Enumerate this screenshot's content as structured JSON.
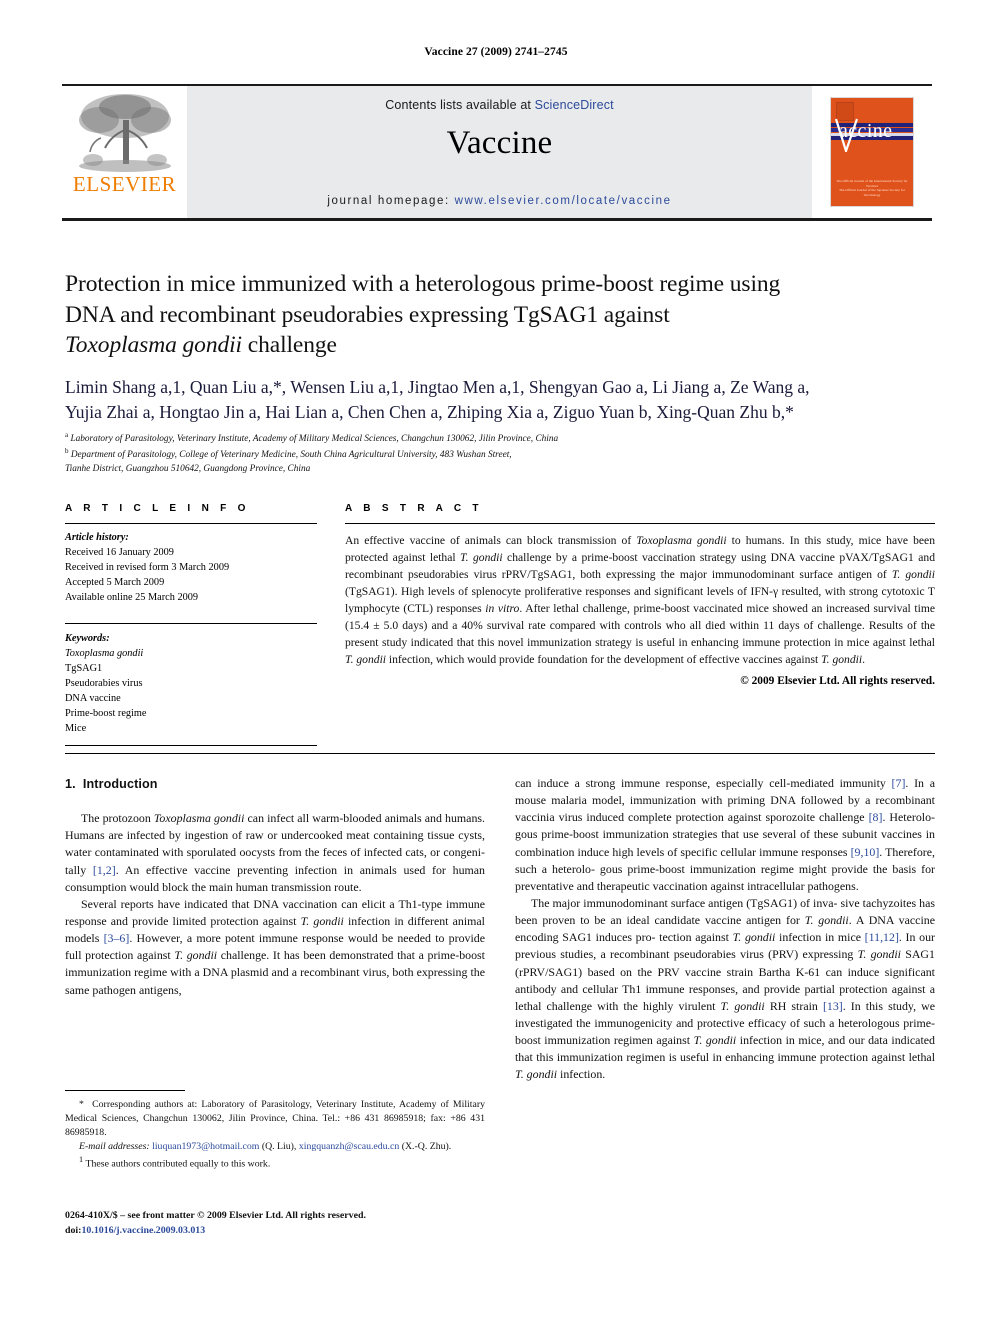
{
  "running_head": "Vaccine 27 (2009) 2741–2745",
  "header": {
    "contents_prefix": "Contents lists available at ",
    "sciencedirect": "ScienceDirect",
    "journal_title": "Vaccine",
    "homepage_prefix": "journal homepage:",
    "homepage_url": "www.elsevier.com/locate/vaccine",
    "publisher": "ELSEVIER",
    "cover_title": "accine",
    "cover_footer_line1": "The Official Journal of the International Society for Vaccines",
    "cover_footer_line2": "The Official Journal of the Japanese Society for Vaccinology",
    "accent_orange": "#ef7d00",
    "cover_orange": "#e0521b",
    "link_blue": "#2b4a9b",
    "band_grey": "#e9eaec"
  },
  "article": {
    "title_line1": "Protection in mice immunized with a heterologous prime-boost regime using",
    "title_line2": "DNA and recombinant pseudorabies expressing TgSAG1 against",
    "title_line3_italic": "Toxoplasma gondii",
    "title_line3_rest": " challenge",
    "authors_line1": "Limin Shang a,1, Quan Liu a,*, Wensen Liu a,1, Jingtao Men a,1, Shengyan Gao a, Li Jiang a, Ze Wang a,",
    "authors_line2": "Yujia Zhai a, Hongtao Jin a, Hai Lian a, Chen Chen a, Zhiping Xia a, Ziguo Yuan b, Xing-Quan Zhu b,*",
    "affiliation_a": "Laboratory of Parasitology, Veterinary Institute, Academy of Military Medical Sciences, Changchun 130062, Jilin Province, China",
    "affiliation_b_line1": "Department of Parasitology, College of Veterinary Medicine, South China Agricultural University, 483 Wushan Street,",
    "affiliation_b_line2": "Tianhe District, Guangzhou 510642, Guangdong Province, China"
  },
  "article_info": {
    "heading": "A R T I C L E   I N F O",
    "history_label": "Article history:",
    "history": [
      "Received 16 January 2009",
      "Received in revised form 3 March 2009",
      "Accepted 5 March 2009",
      "Available online 25 March 2009"
    ],
    "keywords_label": "Keywords:",
    "keywords": [
      "Toxoplasma gondii",
      "TgSAG1",
      "Pseudorabies virus",
      "DNA vaccine",
      "Prime-boost regime",
      "Mice"
    ]
  },
  "abstract": {
    "heading": "A B S T R A C T",
    "copyright": "© 2009 Elsevier Ltd. All rights reserved."
  },
  "body": {
    "section1_number": "1.",
    "section1_title": "Introduction",
    "footnote_corresponding": "Corresponding authors at: Laboratory of Parasitology, Veterinary Institute, Academy of Military Medical Sciences, Changchun 130062, Jilin Province, China. Tel.: +86 431 86985918; fax: +86 431 86985918.",
    "footnote_email_label": "E-mail addresses:",
    "footnote_email1": "liuquan1973@hotmail.com",
    "footnote_email1_owner": "(Q. Liu),",
    "footnote_email2": "xingquanzh@scau.edu.cn",
    "footnote_email2_owner": "(X.-Q. Zhu).",
    "footnote_equal": "These authors contributed equally to this work.",
    "issn_line": "0264-410X/$ – see front matter © 2009 Elsevier Ltd. All rights reserved.",
    "doi_label": "doi:",
    "doi_value": "10.1016/j.vaccine.2009.03.013"
  }
}
